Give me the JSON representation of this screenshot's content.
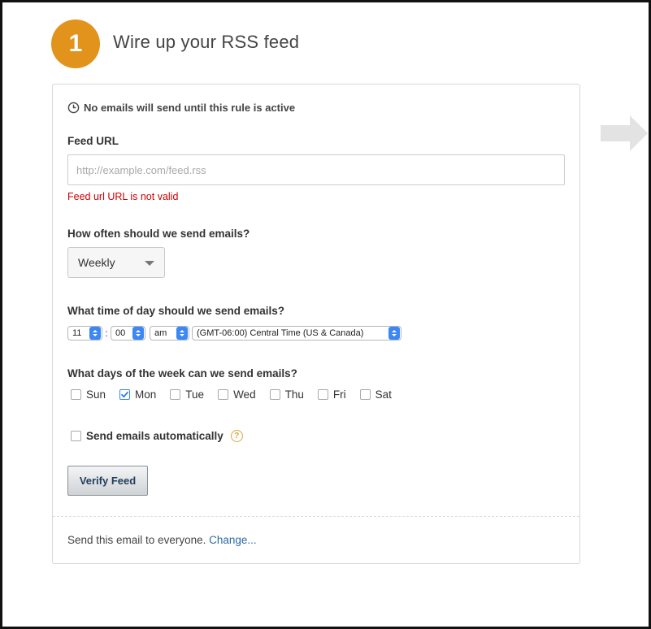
{
  "step": {
    "number": "1",
    "title": "Wire up your RSS feed"
  },
  "notice": {
    "icon": "clock-icon",
    "text": "No emails will send until this rule is active"
  },
  "feed": {
    "label": "Feed URL",
    "value": "",
    "placeholder": "http://example.com/feed.rss",
    "error": "Feed url URL is not valid"
  },
  "frequency": {
    "label": "How often should we send emails?",
    "selected": "Weekly"
  },
  "time": {
    "label": "What time of day should we send emails?",
    "hour": "11",
    "separator": ":",
    "minute": "00",
    "ampm": "am",
    "timezone": "(GMT-06:00) Central Time (US & Canada)"
  },
  "days": {
    "label": "What days of the week can we send emails?",
    "items": [
      {
        "label": "Sun",
        "checked": false
      },
      {
        "label": "Mon",
        "checked": true
      },
      {
        "label": "Tue",
        "checked": false
      },
      {
        "label": "Wed",
        "checked": false
      },
      {
        "label": "Thu",
        "checked": false
      },
      {
        "label": "Fri",
        "checked": false
      },
      {
        "label": "Sat",
        "checked": false
      }
    ]
  },
  "auto_send": {
    "label": "Send emails automatically",
    "checked": false,
    "help_glyph": "?"
  },
  "verify_button": "Verify Feed",
  "footer": {
    "text": "Send this email to everyone.",
    "link": "Change..."
  },
  "colors": {
    "accent": "#e2931c",
    "error": "#cc0000",
    "link": "#2d6aa3",
    "select_blue": "#3b87f5"
  }
}
